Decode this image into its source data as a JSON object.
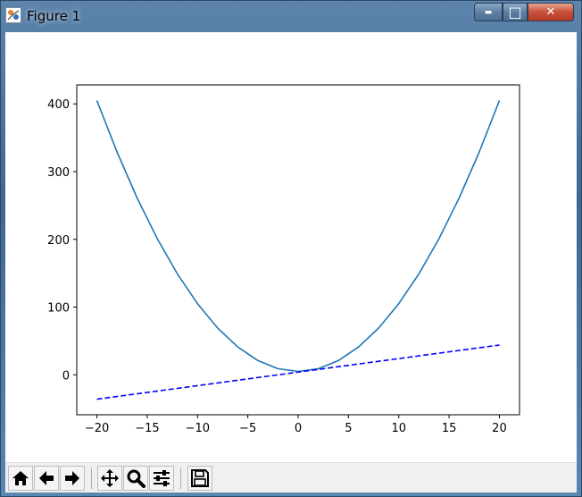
{
  "window": {
    "title": "Figure 1",
    "minimize_symbol": "▬",
    "maximize_symbol": "□",
    "close_symbol": "✕"
  },
  "toolbar": {
    "buttons": [
      {
        "name": "home-button",
        "icon": "home-icon"
      },
      {
        "name": "back-button",
        "icon": "arrow-left-icon"
      },
      {
        "name": "forward-button",
        "icon": "arrow-right-icon"
      },
      {
        "name": "pan-button",
        "icon": "move-icon"
      },
      {
        "name": "zoom-button",
        "icon": "magnifier-icon"
      },
      {
        "name": "configure-subplots-button",
        "icon": "sliders-icon"
      },
      {
        "name": "save-button",
        "icon": "floppy-disk-icon"
      }
    ]
  },
  "chart_data": {
    "type": "line",
    "title": "",
    "xlabel": "",
    "ylabel": "",
    "xlim": [
      -22,
      22
    ],
    "ylim": [
      -59,
      428
    ],
    "xticks": [
      -20,
      -15,
      -10,
      -5,
      0,
      5,
      10,
      15,
      20
    ],
    "xtick_labels": [
      "−20",
      "−15",
      "−10",
      "−5",
      "0",
      "5",
      "10",
      "15",
      "20"
    ],
    "yticks": [
      0,
      100,
      200,
      300,
      400
    ],
    "ytick_labels": [
      "0",
      "100",
      "200",
      "300",
      "400"
    ],
    "grid": false,
    "legend": "none",
    "series": [
      {
        "style": "solid",
        "color": "#1f77b4",
        "x": [
          -20,
          -18,
          -16,
          -14,
          -12,
          -10,
          -8,
          -6,
          -4,
          -2,
          0,
          2,
          4,
          6,
          8,
          10,
          12,
          14,
          16,
          18,
          20
        ],
        "y": [
          405,
          329,
          261,
          201,
          149,
          105,
          69,
          41,
          21,
          9,
          5,
          9,
          21,
          41,
          69,
          105,
          149,
          201,
          261,
          329,
          405
        ]
      },
      {
        "style": "dashed",
        "color": "#0000ff",
        "x": [
          -20,
          20
        ],
        "y": [
          -36,
          44
        ]
      }
    ]
  }
}
